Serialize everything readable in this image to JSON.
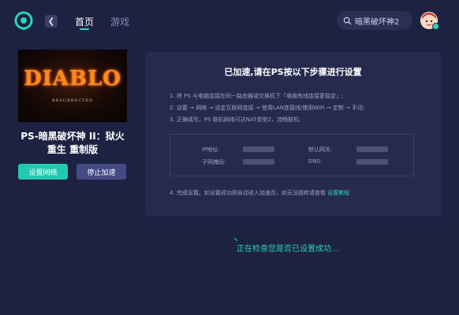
{
  "colors": {
    "background": "#1d2142",
    "accent": "#2ad4b7",
    "panel": "#262a4e",
    "stop_button": "#434a84"
  },
  "header": {
    "logo_icon": "power-logo-icon",
    "back_icon": "chevron-left-icon",
    "tabs": [
      {
        "label": "首页",
        "active": true
      },
      {
        "label": "游戏",
        "active": false
      }
    ],
    "search": {
      "icon": "search-icon",
      "value": "暗黑破坏神2"
    },
    "avatar": {
      "badge_icon": "diamond-badge-icon"
    }
  },
  "game": {
    "cover_title": "DIABLO",
    "cover_subtitle": "RESURRECTED",
    "title_line1": "PS-暗黑破坏神 II：狱火",
    "title_line2": "重生 重制版",
    "setup_button": "设置网络",
    "stop_button": "停止加速"
  },
  "panel": {
    "title": "已加速,请在PS按以下步骤进行设置",
    "step1": "1. 将 PS 与电脑连接在同一路由器或交换机下「电脑有线连接更稳定」;",
    "step2": "2. 设置 → 网络 → 设定互联网连接 → 使用LAN连接线/使用WiFi → 定制 → 手动;",
    "step3": "3. 正确填写，PS 联机网络可达NAT类型2，流畅联机;",
    "net": {
      "ip_label": "IP地址:",
      "mask_label": "子网掩码:",
      "gateway_label": "默认网关:",
      "dns_label": "DNS:"
    },
    "step4": "4. 完成设置。如设置成功则自动进入加速页，如无法跳转请查看",
    "step4_link": "设置教程"
  },
  "status": {
    "checking": "正在检查您是否已设置成功..."
  }
}
